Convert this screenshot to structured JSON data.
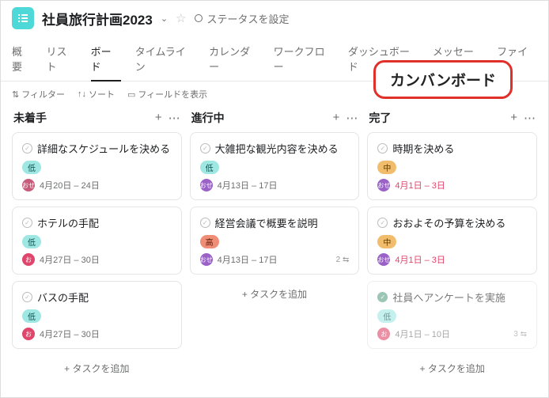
{
  "header": {
    "title": "社員旅行計画2023",
    "status": "ステータスを設定"
  },
  "tabs": [
    "概要",
    "リスト",
    "ボード",
    "タイムライン",
    "カレンダー",
    "ワークフロー",
    "ダッシュボード",
    "メッセージ",
    "ファイル"
  ],
  "toolbar": {
    "filter": "フィルター",
    "sort": "ソート",
    "fields": "フィールドを表示"
  },
  "callout": "カンバンボード",
  "addTask": "+ タスクを追加",
  "cols": [
    {
      "title": "未着手",
      "cards": [
        {
          "title": "詳細なスケジュールを決める",
          "badge": "低",
          "bcls": "b-low",
          "av": "a1",
          "avt": "おせ",
          "date": "4月20日 – 24日"
        },
        {
          "title": "ホテルの手配",
          "badge": "低",
          "bcls": "b-low",
          "av": "a3",
          "avt": "お",
          "date": "4月27日 – 30日"
        },
        {
          "title": "バスの手配",
          "badge": "低",
          "bcls": "b-low",
          "av": "a3",
          "avt": "お",
          "date": "4月27日 – 30日"
        }
      ]
    },
    {
      "title": "進行中",
      "cards": [
        {
          "title": "大雑把な観光内容を決める",
          "badge": "低",
          "bcls": "b-low",
          "av": "a2",
          "avt": "おせ",
          "date": "4月13日 – 17日"
        },
        {
          "title": "経営会議で概要を説明",
          "badge": "高",
          "bcls": "b-high",
          "av": "a2",
          "avt": "おせ",
          "date": "4月13日 – 17日",
          "sub": "2 ⇆"
        }
      ]
    },
    {
      "title": "完了",
      "cards": [
        {
          "title": "時期を決める",
          "badge": "中",
          "bcls": "b-mid",
          "av": "a2",
          "avt": "おせ",
          "date": "4月1日 – 3日",
          "red": true
        },
        {
          "title": "おおよその予算を決める",
          "badge": "中",
          "bcls": "b-mid",
          "av": "a2",
          "avt": "おせ",
          "date": "4月1日 – 3日",
          "red": true
        },
        {
          "title": "社員へアンケートを実施",
          "badge": "低",
          "bcls": "b-low",
          "av": "a3",
          "avt": "お",
          "date": "4月1日 – 10日",
          "sub": "3 ⇆",
          "done": true
        }
      ]
    }
  ]
}
